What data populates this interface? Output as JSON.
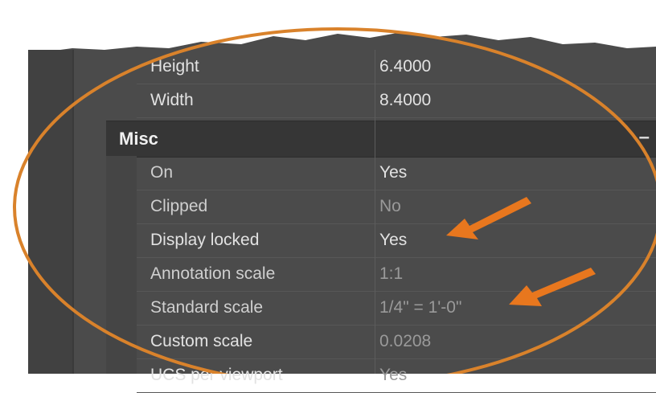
{
  "properties": {
    "rows_top": [
      {
        "label": "Height",
        "value": "6.4000"
      },
      {
        "label": "Width",
        "value": "8.4000"
      }
    ],
    "section": {
      "title": "Misc",
      "collapse_symbol": "–"
    },
    "misc_rows": [
      {
        "label": "On",
        "value": "Yes"
      },
      {
        "label": "Clipped",
        "value": "No"
      },
      {
        "label": "Display locked",
        "value": "Yes"
      },
      {
        "label": "Annotation scale",
        "value": "1:1"
      },
      {
        "label": "Standard scale",
        "value": "1/4\" = 1'-0\""
      },
      {
        "label": "Custom scale",
        "value": "0.0208"
      },
      {
        "label": "UCS per viewport",
        "value": "Yes"
      }
    ]
  },
  "annotations": {
    "ellipse_color": "#d9822b",
    "arrow_color": "#e8771e",
    "icons": [
      "orange-ellipse-highlight",
      "arrow-icon",
      "arrow-icon"
    ]
  }
}
